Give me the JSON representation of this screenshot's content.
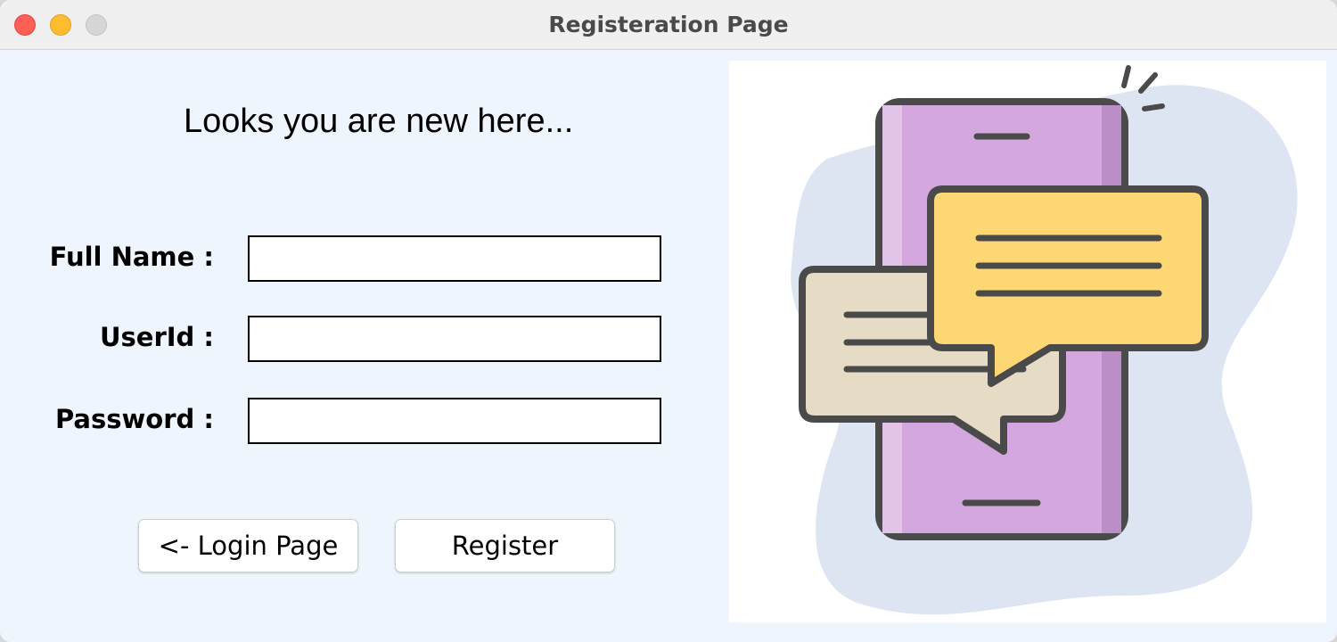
{
  "window": {
    "title": "Registeration Page"
  },
  "form": {
    "heading": "Looks you are new here...",
    "full_name": {
      "label": "Full Name :",
      "value": ""
    },
    "user_id": {
      "label": "UserId :",
      "value": ""
    },
    "password": {
      "label": "Password :",
      "value": ""
    }
  },
  "buttons": {
    "login_label": "<- Login Page",
    "register_label": "Register"
  },
  "illustration": {
    "icon": "smartphone-chat-bubbles-illustration",
    "colors": {
      "blob": "#dde4f2",
      "phone": "#d4a8de",
      "bubble_front": "#fed775",
      "bubble_back": "#e6dcc5",
      "outline": "#4a4a4a"
    }
  }
}
